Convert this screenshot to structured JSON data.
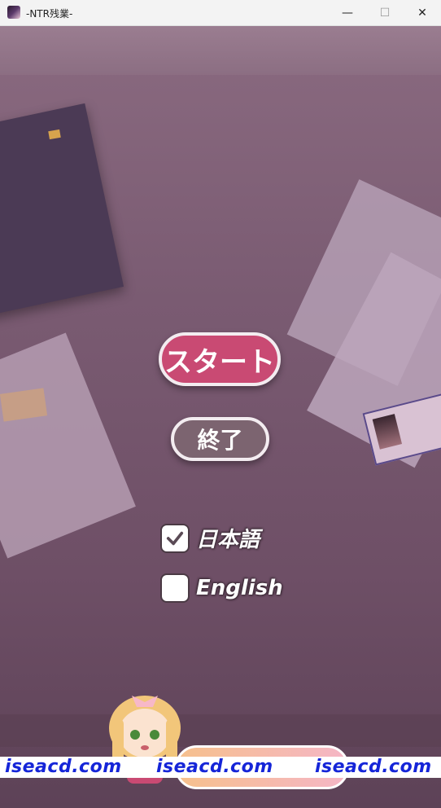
{
  "window": {
    "title": "-NTR残業-",
    "controls": {
      "minimize": "—",
      "maximize": "☐",
      "close": "✕"
    }
  },
  "menu": {
    "start_label": "スタート",
    "quit_label": "終了"
  },
  "language": {
    "options": [
      {
        "label": "日本語",
        "checked": true
      },
      {
        "label": "English",
        "checked": false
      }
    ]
  },
  "watermark": {
    "text": "iseacd.com",
    "color": "#1525d8"
  },
  "colors": {
    "start_button": "#c94a73",
    "quit_button": "#7c6470",
    "background": "#6e4f66"
  }
}
